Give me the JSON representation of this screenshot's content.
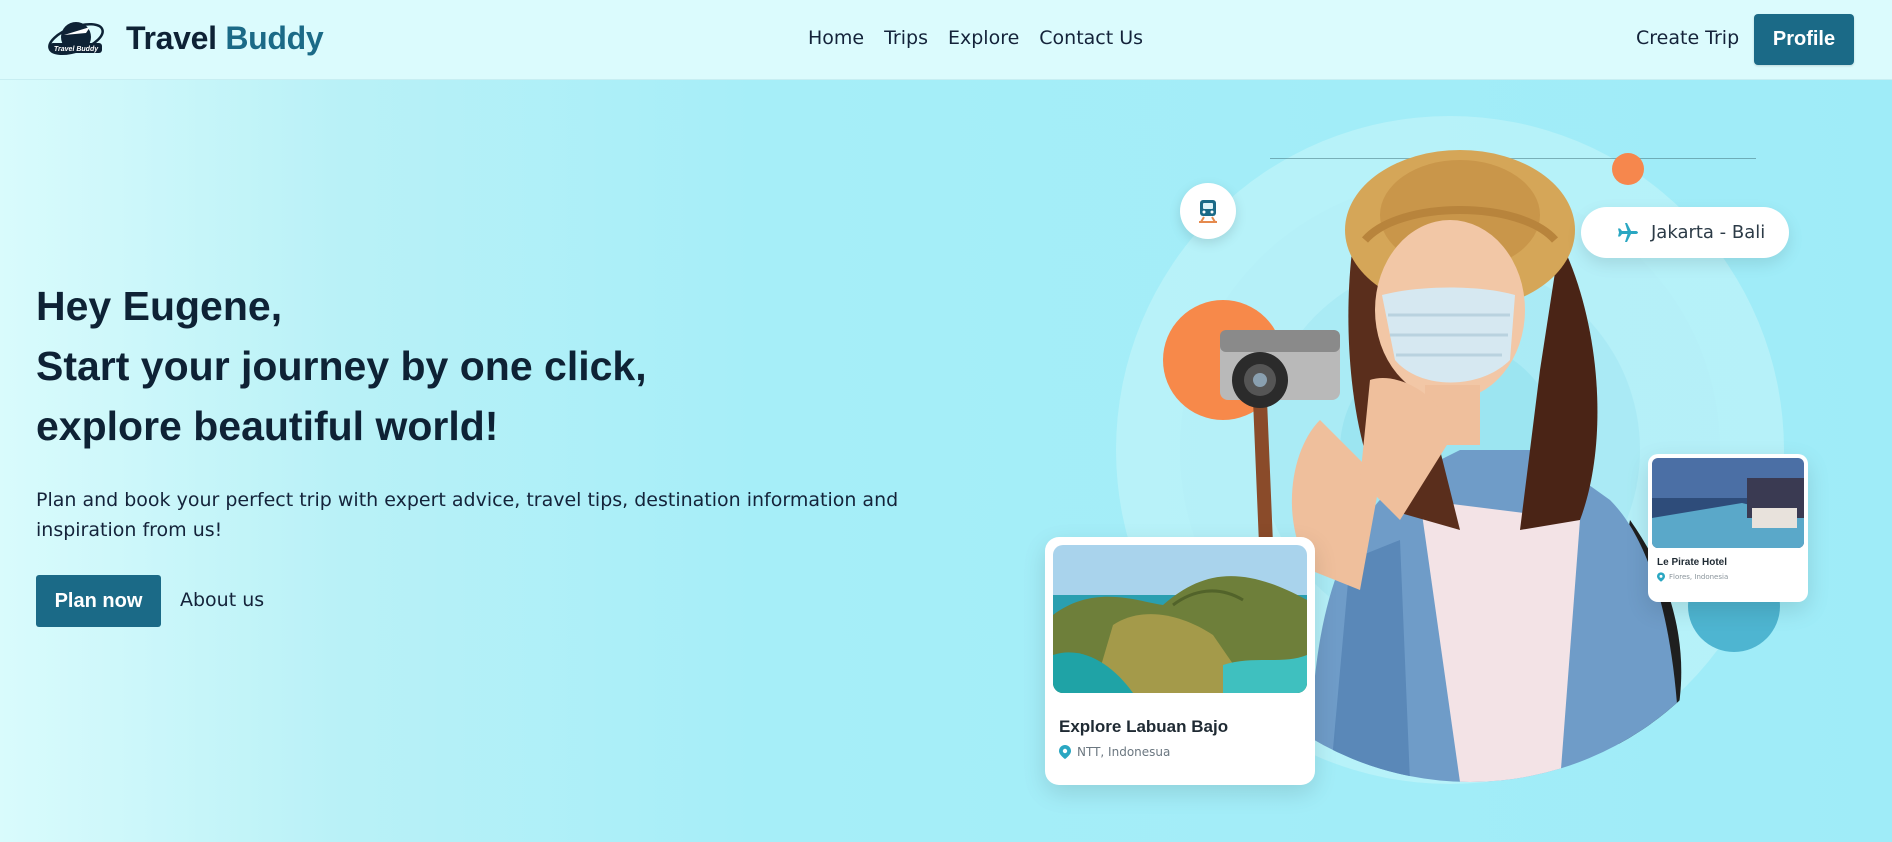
{
  "nav": {
    "brand_main": "Travel",
    "brand_accent": "Buddy",
    "logo_text": "Travel Buddy",
    "links": [
      "Home",
      "Trips",
      "Explore",
      "Contact Us"
    ],
    "create_trip": "Create Trip",
    "profile": "Profile"
  },
  "hero": {
    "greeting": "Hey Eugene,",
    "line2": "Start your journey by one click,",
    "line3": "explore beautiful world!",
    "subtext": "Plan and book your perfect trip with expert advice, travel tips, destination information and inspiration from us!",
    "plan_button": "Plan now",
    "about_link": "About us"
  },
  "route": {
    "label": "Jakarta - Bali",
    "icon": "plane-icon"
  },
  "train_icon": "train-icon",
  "cards": {
    "main": {
      "title": "Explore Labuan Bajo",
      "location": "NTT, Indonesua"
    },
    "small": {
      "title": "Le Pirate Hotel",
      "location": "Flores, Indonesia"
    }
  },
  "colors": {
    "primary": "#1b6a87",
    "accent_orange": "#f7894a",
    "text_dark": "#0e2235",
    "background": "#a6eef8"
  }
}
